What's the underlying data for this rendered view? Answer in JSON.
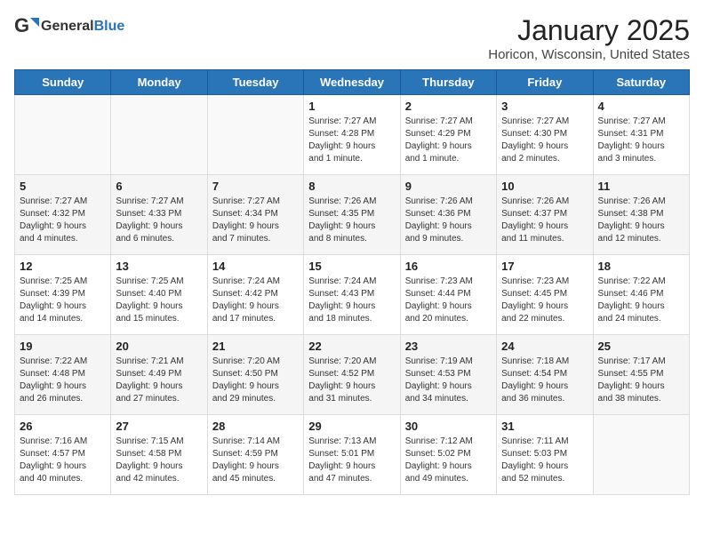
{
  "header": {
    "logo_general": "General",
    "logo_blue": "Blue",
    "title": "January 2025",
    "subtitle": "Horicon, Wisconsin, United States"
  },
  "weekdays": [
    "Sunday",
    "Monday",
    "Tuesday",
    "Wednesday",
    "Thursday",
    "Friday",
    "Saturday"
  ],
  "weeks": [
    [
      {
        "day": "",
        "info": ""
      },
      {
        "day": "",
        "info": ""
      },
      {
        "day": "",
        "info": ""
      },
      {
        "day": "1",
        "info": "Sunrise: 7:27 AM\nSunset: 4:28 PM\nDaylight: 9 hours\nand 1 minute."
      },
      {
        "day": "2",
        "info": "Sunrise: 7:27 AM\nSunset: 4:29 PM\nDaylight: 9 hours\nand 1 minute."
      },
      {
        "day": "3",
        "info": "Sunrise: 7:27 AM\nSunset: 4:30 PM\nDaylight: 9 hours\nand 2 minutes."
      },
      {
        "day": "4",
        "info": "Sunrise: 7:27 AM\nSunset: 4:31 PM\nDaylight: 9 hours\nand 3 minutes."
      }
    ],
    [
      {
        "day": "5",
        "info": "Sunrise: 7:27 AM\nSunset: 4:32 PM\nDaylight: 9 hours\nand 4 minutes."
      },
      {
        "day": "6",
        "info": "Sunrise: 7:27 AM\nSunset: 4:33 PM\nDaylight: 9 hours\nand 6 minutes."
      },
      {
        "day": "7",
        "info": "Sunrise: 7:27 AM\nSunset: 4:34 PM\nDaylight: 9 hours\nand 7 minutes."
      },
      {
        "day": "8",
        "info": "Sunrise: 7:26 AM\nSunset: 4:35 PM\nDaylight: 9 hours\nand 8 minutes."
      },
      {
        "day": "9",
        "info": "Sunrise: 7:26 AM\nSunset: 4:36 PM\nDaylight: 9 hours\nand 9 minutes."
      },
      {
        "day": "10",
        "info": "Sunrise: 7:26 AM\nSunset: 4:37 PM\nDaylight: 9 hours\nand 11 minutes."
      },
      {
        "day": "11",
        "info": "Sunrise: 7:26 AM\nSunset: 4:38 PM\nDaylight: 9 hours\nand 12 minutes."
      }
    ],
    [
      {
        "day": "12",
        "info": "Sunrise: 7:25 AM\nSunset: 4:39 PM\nDaylight: 9 hours\nand 14 minutes."
      },
      {
        "day": "13",
        "info": "Sunrise: 7:25 AM\nSunset: 4:40 PM\nDaylight: 9 hours\nand 15 minutes."
      },
      {
        "day": "14",
        "info": "Sunrise: 7:24 AM\nSunset: 4:42 PM\nDaylight: 9 hours\nand 17 minutes."
      },
      {
        "day": "15",
        "info": "Sunrise: 7:24 AM\nSunset: 4:43 PM\nDaylight: 9 hours\nand 18 minutes."
      },
      {
        "day": "16",
        "info": "Sunrise: 7:23 AM\nSunset: 4:44 PM\nDaylight: 9 hours\nand 20 minutes."
      },
      {
        "day": "17",
        "info": "Sunrise: 7:23 AM\nSunset: 4:45 PM\nDaylight: 9 hours\nand 22 minutes."
      },
      {
        "day": "18",
        "info": "Sunrise: 7:22 AM\nSunset: 4:46 PM\nDaylight: 9 hours\nand 24 minutes."
      }
    ],
    [
      {
        "day": "19",
        "info": "Sunrise: 7:22 AM\nSunset: 4:48 PM\nDaylight: 9 hours\nand 26 minutes."
      },
      {
        "day": "20",
        "info": "Sunrise: 7:21 AM\nSunset: 4:49 PM\nDaylight: 9 hours\nand 27 minutes."
      },
      {
        "day": "21",
        "info": "Sunrise: 7:20 AM\nSunset: 4:50 PM\nDaylight: 9 hours\nand 29 minutes."
      },
      {
        "day": "22",
        "info": "Sunrise: 7:20 AM\nSunset: 4:52 PM\nDaylight: 9 hours\nand 31 minutes."
      },
      {
        "day": "23",
        "info": "Sunrise: 7:19 AM\nSunset: 4:53 PM\nDaylight: 9 hours\nand 34 minutes."
      },
      {
        "day": "24",
        "info": "Sunrise: 7:18 AM\nSunset: 4:54 PM\nDaylight: 9 hours\nand 36 minutes."
      },
      {
        "day": "25",
        "info": "Sunrise: 7:17 AM\nSunset: 4:55 PM\nDaylight: 9 hours\nand 38 minutes."
      }
    ],
    [
      {
        "day": "26",
        "info": "Sunrise: 7:16 AM\nSunset: 4:57 PM\nDaylight: 9 hours\nand 40 minutes."
      },
      {
        "day": "27",
        "info": "Sunrise: 7:15 AM\nSunset: 4:58 PM\nDaylight: 9 hours\nand 42 minutes."
      },
      {
        "day": "28",
        "info": "Sunrise: 7:14 AM\nSunset: 4:59 PM\nDaylight: 9 hours\nand 45 minutes."
      },
      {
        "day": "29",
        "info": "Sunrise: 7:13 AM\nSunset: 5:01 PM\nDaylight: 9 hours\nand 47 minutes."
      },
      {
        "day": "30",
        "info": "Sunrise: 7:12 AM\nSunset: 5:02 PM\nDaylight: 9 hours\nand 49 minutes."
      },
      {
        "day": "31",
        "info": "Sunrise: 7:11 AM\nSunset: 5:03 PM\nDaylight: 9 hours\nand 52 minutes."
      },
      {
        "day": "",
        "info": ""
      }
    ]
  ]
}
